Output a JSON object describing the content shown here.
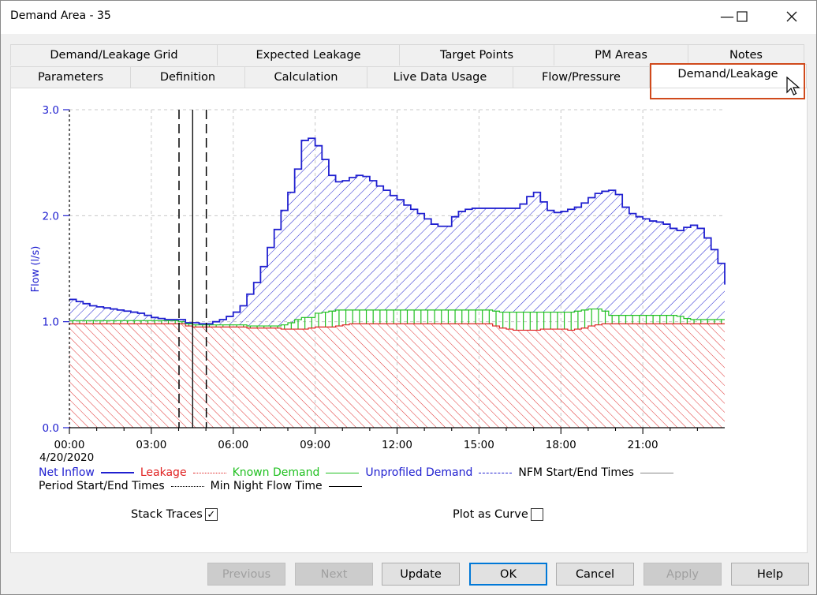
{
  "window": {
    "title": "Demand Area - 35",
    "controls": {
      "minimize": "—",
      "maximize": "☐",
      "close": "✕"
    }
  },
  "tabs": {
    "row_top": [
      {
        "label": "Demand/Leakage Grid"
      },
      {
        "label": "Expected Leakage"
      },
      {
        "label": "Target Points"
      },
      {
        "label": "PM Areas"
      },
      {
        "label": "Notes"
      }
    ],
    "row_bottom": [
      {
        "label": "Parameters"
      },
      {
        "label": "Definition"
      },
      {
        "label": "Calculation"
      },
      {
        "label": "Live Data Usage"
      },
      {
        "label": "Flow/Pressure"
      },
      {
        "label": "Demand/Leakage",
        "active": true
      }
    ]
  },
  "options": {
    "stack_traces_label": "Stack Traces",
    "stack_traces_checked": true,
    "plot_as_curve_label": "Plot as Curve",
    "plot_as_curve_checked": false
  },
  "buttons": {
    "previous": "Previous",
    "next": "Next",
    "update": "Update",
    "ok": "OK",
    "cancel": "Cancel",
    "apply": "Apply",
    "help": "Help"
  },
  "colors": {
    "net_inflow": "#2020d0",
    "leakage": "#e02020",
    "known_demand": "#20c020",
    "unprofiled_demand": "#2020d0",
    "highlight": "#d04a1c",
    "axis_label": "#2020d0"
  },
  "chart_data": {
    "type": "area",
    "stacked": true,
    "step": true,
    "title": "",
    "xlabel": "",
    "ylabel": "Flow (l/s)",
    "date_label": "4/20/2020",
    "ylim": [
      0,
      3.0
    ],
    "yticks": [
      "0.0",
      "1.0",
      "2.0",
      "3.0"
    ],
    "xlim_hours": [
      0,
      24
    ],
    "xticks": [
      "00:00",
      "03:00",
      "06:00",
      "09:00",
      "12:00",
      "15:00",
      "18:00",
      "21:00"
    ],
    "grid": true,
    "interval_minutes": 15,
    "legend": [
      {
        "label": "Net Inflow",
        "style": "solid",
        "color": "#2020d0"
      },
      {
        "label": "Leakage",
        "style": "dotted",
        "color": "#e02020"
      },
      {
        "label": "Known Demand",
        "style": "solid",
        "color": "#20c020"
      },
      {
        "label": "Unprofiled Demand",
        "style": "dashed",
        "color": "#2020d0"
      },
      {
        "label": "NFM Start/End Times",
        "style": "solid",
        "color": "#888888"
      },
      {
        "label": "Period Start/End Times",
        "style": "dotted",
        "color": "#000000"
      },
      {
        "label": "Min Night Flow Time",
        "style": "solid",
        "color": "#000000"
      }
    ],
    "markers": {
      "period_start_hours": 0,
      "nfm_start_hours": 4.0,
      "min_night_flow_hours": 4.5,
      "nfm_end_hours": 5.0
    },
    "series": [
      {
        "name": "Net Inflow",
        "values": [
          1.21,
          1.19,
          1.17,
          1.15,
          1.14,
          1.13,
          1.12,
          1.11,
          1.1,
          1.09,
          1.08,
          1.06,
          1.04,
          1.03,
          1.02,
          1.02,
          1.02,
          0.99,
          0.99,
          0.98,
          0.98,
          1.0,
          1.02,
          1.05,
          1.09,
          1.15,
          1.26,
          1.37,
          1.52,
          1.7,
          1.87,
          2.05,
          2.22,
          2.44,
          2.71,
          2.73,
          2.66,
          2.53,
          2.38,
          2.32,
          2.33,
          2.36,
          2.38,
          2.37,
          2.33,
          2.28,
          2.24,
          2.19,
          2.15,
          2.1,
          2.06,
          2.02,
          1.97,
          1.92,
          1.9,
          1.9,
          1.99,
          2.04,
          2.06,
          2.07,
          2.07,
          2.07,
          2.07,
          2.07,
          2.07,
          2.07,
          2.11,
          2.18,
          2.22,
          2.13,
          2.05,
          2.03,
          2.04,
          2.06,
          2.08,
          2.12,
          2.17,
          2.21,
          2.23,
          2.24,
          2.2,
          2.08,
          2.02,
          1.99,
          1.97,
          1.95,
          1.94,
          1.92,
          1.88,
          1.86,
          1.89,
          1.91,
          1.88,
          1.79,
          1.68,
          1.55,
          1.35
        ]
      },
      {
        "name": "Known Demand",
        "values": [
          1.01,
          1.01,
          1.01,
          1.01,
          1.01,
          1.01,
          1.01,
          1.01,
          1.01,
          1.01,
          1.01,
          1.01,
          1.01,
          1.01,
          1.01,
          1.01,
          1.0,
          0.98,
          0.97,
          0.97,
          0.97,
          0.97,
          0.97,
          0.97,
          0.97,
          0.97,
          0.96,
          0.96,
          0.96,
          0.96,
          0.96,
          0.97,
          0.99,
          1.02,
          1.04,
          1.04,
          1.08,
          1.09,
          1.1,
          1.11,
          1.11,
          1.11,
          1.11,
          1.11,
          1.11,
          1.11,
          1.11,
          1.11,
          1.11,
          1.11,
          1.11,
          1.11,
          1.11,
          1.11,
          1.11,
          1.11,
          1.11,
          1.11,
          1.11,
          1.11,
          1.11,
          1.11,
          1.1,
          1.09,
          1.09,
          1.09,
          1.09,
          1.09,
          1.09,
          1.09,
          1.09,
          1.09,
          1.09,
          1.09,
          1.1,
          1.11,
          1.12,
          1.12,
          1.1,
          1.06,
          1.06,
          1.06,
          1.06,
          1.06,
          1.06,
          1.06,
          1.06,
          1.06,
          1.06,
          1.05,
          1.03,
          1.02,
          1.02,
          1.02,
          1.02,
          1.02
        ]
      },
      {
        "name": "Leakage",
        "values": [
          0.98,
          0.98,
          0.98,
          0.98,
          0.98,
          0.98,
          0.98,
          0.98,
          0.98,
          0.98,
          0.98,
          0.98,
          0.98,
          0.98,
          0.98,
          0.98,
          0.98,
          0.96,
          0.95,
          0.95,
          0.95,
          0.95,
          0.95,
          0.95,
          0.95,
          0.95,
          0.94,
          0.94,
          0.94,
          0.94,
          0.94,
          0.93,
          0.93,
          0.93,
          0.93,
          0.94,
          0.95,
          0.95,
          0.95,
          0.96,
          0.97,
          0.98,
          0.98,
          0.98,
          0.98,
          0.98,
          0.98,
          0.98,
          0.98,
          0.98,
          0.98,
          0.98,
          0.98,
          0.98,
          0.98,
          0.98,
          0.98,
          0.98,
          0.98,
          0.98,
          0.98,
          0.98,
          0.96,
          0.94,
          0.93,
          0.92,
          0.92,
          0.92,
          0.92,
          0.93,
          0.93,
          0.93,
          0.93,
          0.92,
          0.93,
          0.94,
          0.96,
          0.97,
          0.98,
          0.98,
          0.98,
          0.98,
          0.98,
          0.98,
          0.98,
          0.98,
          0.98,
          0.98,
          0.98,
          0.98,
          0.98,
          0.98,
          0.98,
          0.98,
          0.98,
          0.98
        ]
      }
    ]
  }
}
